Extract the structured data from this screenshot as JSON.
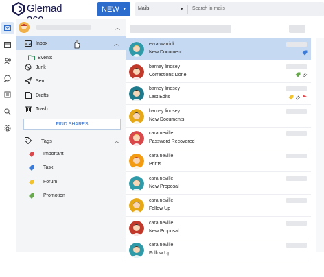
{
  "app": {
    "brand": "Glemad 360"
  },
  "toolbar": {
    "new_label": "NEW",
    "new_caret": "▾"
  },
  "search": {
    "scope": "Mails",
    "scope_caret": "▾",
    "placeholder": "Search in mails"
  },
  "rail": {
    "icons": [
      "mail-icon",
      "calendar-icon",
      "contacts-icon",
      "chat-icon",
      "files-icon",
      "search-icon",
      "settings-icon"
    ]
  },
  "folders": {
    "items": [
      {
        "label": "Inbox",
        "icon": "inbox-icon",
        "selected": true
      },
      {
        "label": "Events",
        "icon": "folder-icon",
        "sub": true
      },
      {
        "label": "Junk",
        "icon": "junk-icon"
      },
      {
        "label": "Sent",
        "icon": "sent-icon"
      },
      {
        "label": "Drafts",
        "icon": "drafts-icon"
      },
      {
        "label": "Trash",
        "icon": "trash-icon"
      }
    ],
    "find_shares": "FIND SHARES"
  },
  "tags": {
    "header": "Tags",
    "items": [
      {
        "label": "Important",
        "color": "#d9484b"
      },
      {
        "label": "Task",
        "color": "#3b7bd6"
      },
      {
        "label": "Forum",
        "color": "#f1c232"
      },
      {
        "label": "Promotion",
        "color": "#6aa84f"
      }
    ]
  },
  "messages": [
    {
      "from": "ezra warrick",
      "subject": "New Document",
      "avatar_bg": "#2f9aa8",
      "avatar_hair": "#f2c94c",
      "selected": true,
      "flags": [
        "#3b7bd6"
      ]
    },
    {
      "from": "barney lindsey",
      "subject": "Corrections Done",
      "avatar_bg": "#c0392b",
      "avatar_hair": "#3a2a1a",
      "flags": [
        "#6aa84f",
        "clip"
      ]
    },
    {
      "from": "barney lindsey",
      "subject": "Last Edits",
      "avatar_bg": "#1f7a8c",
      "avatar_hair": "#2b1d12",
      "flags": [
        "#f1c232",
        "clip",
        "flag"
      ]
    },
    {
      "from": "barney lindsey",
      "subject": "New Documents",
      "avatar_bg": "#e6a817",
      "avatar_hair": "#3a2a1a",
      "flags": []
    },
    {
      "from": "cara neville",
      "subject": "Password Recovered",
      "avatar_bg": "#d9484b",
      "avatar_hair": "#f2c94c",
      "flags": []
    },
    {
      "from": "cara neville",
      "subject": "Prints",
      "avatar_bg": "#f39c12",
      "avatar_hair": "#c0392b",
      "flags": []
    },
    {
      "from": "cara neville",
      "subject": "New Proposal",
      "avatar_bg": "#2f9aa8",
      "avatar_hair": "#3a2a1a",
      "flags": []
    },
    {
      "from": "cara neville",
      "subject": "Follow Up",
      "avatar_bg": "#e6a817",
      "avatar_hair": "#2b1d12",
      "flags": []
    },
    {
      "from": "cara neville",
      "subject": "New Proposal",
      "avatar_bg": "#c0392b",
      "avatar_hair": "#1a1a1a",
      "flags": []
    },
    {
      "from": "cara neville",
      "subject": "Follow Up",
      "avatar_bg": "#2f9aa8",
      "avatar_hair": "#3a2a1a",
      "flags": []
    }
  ]
}
